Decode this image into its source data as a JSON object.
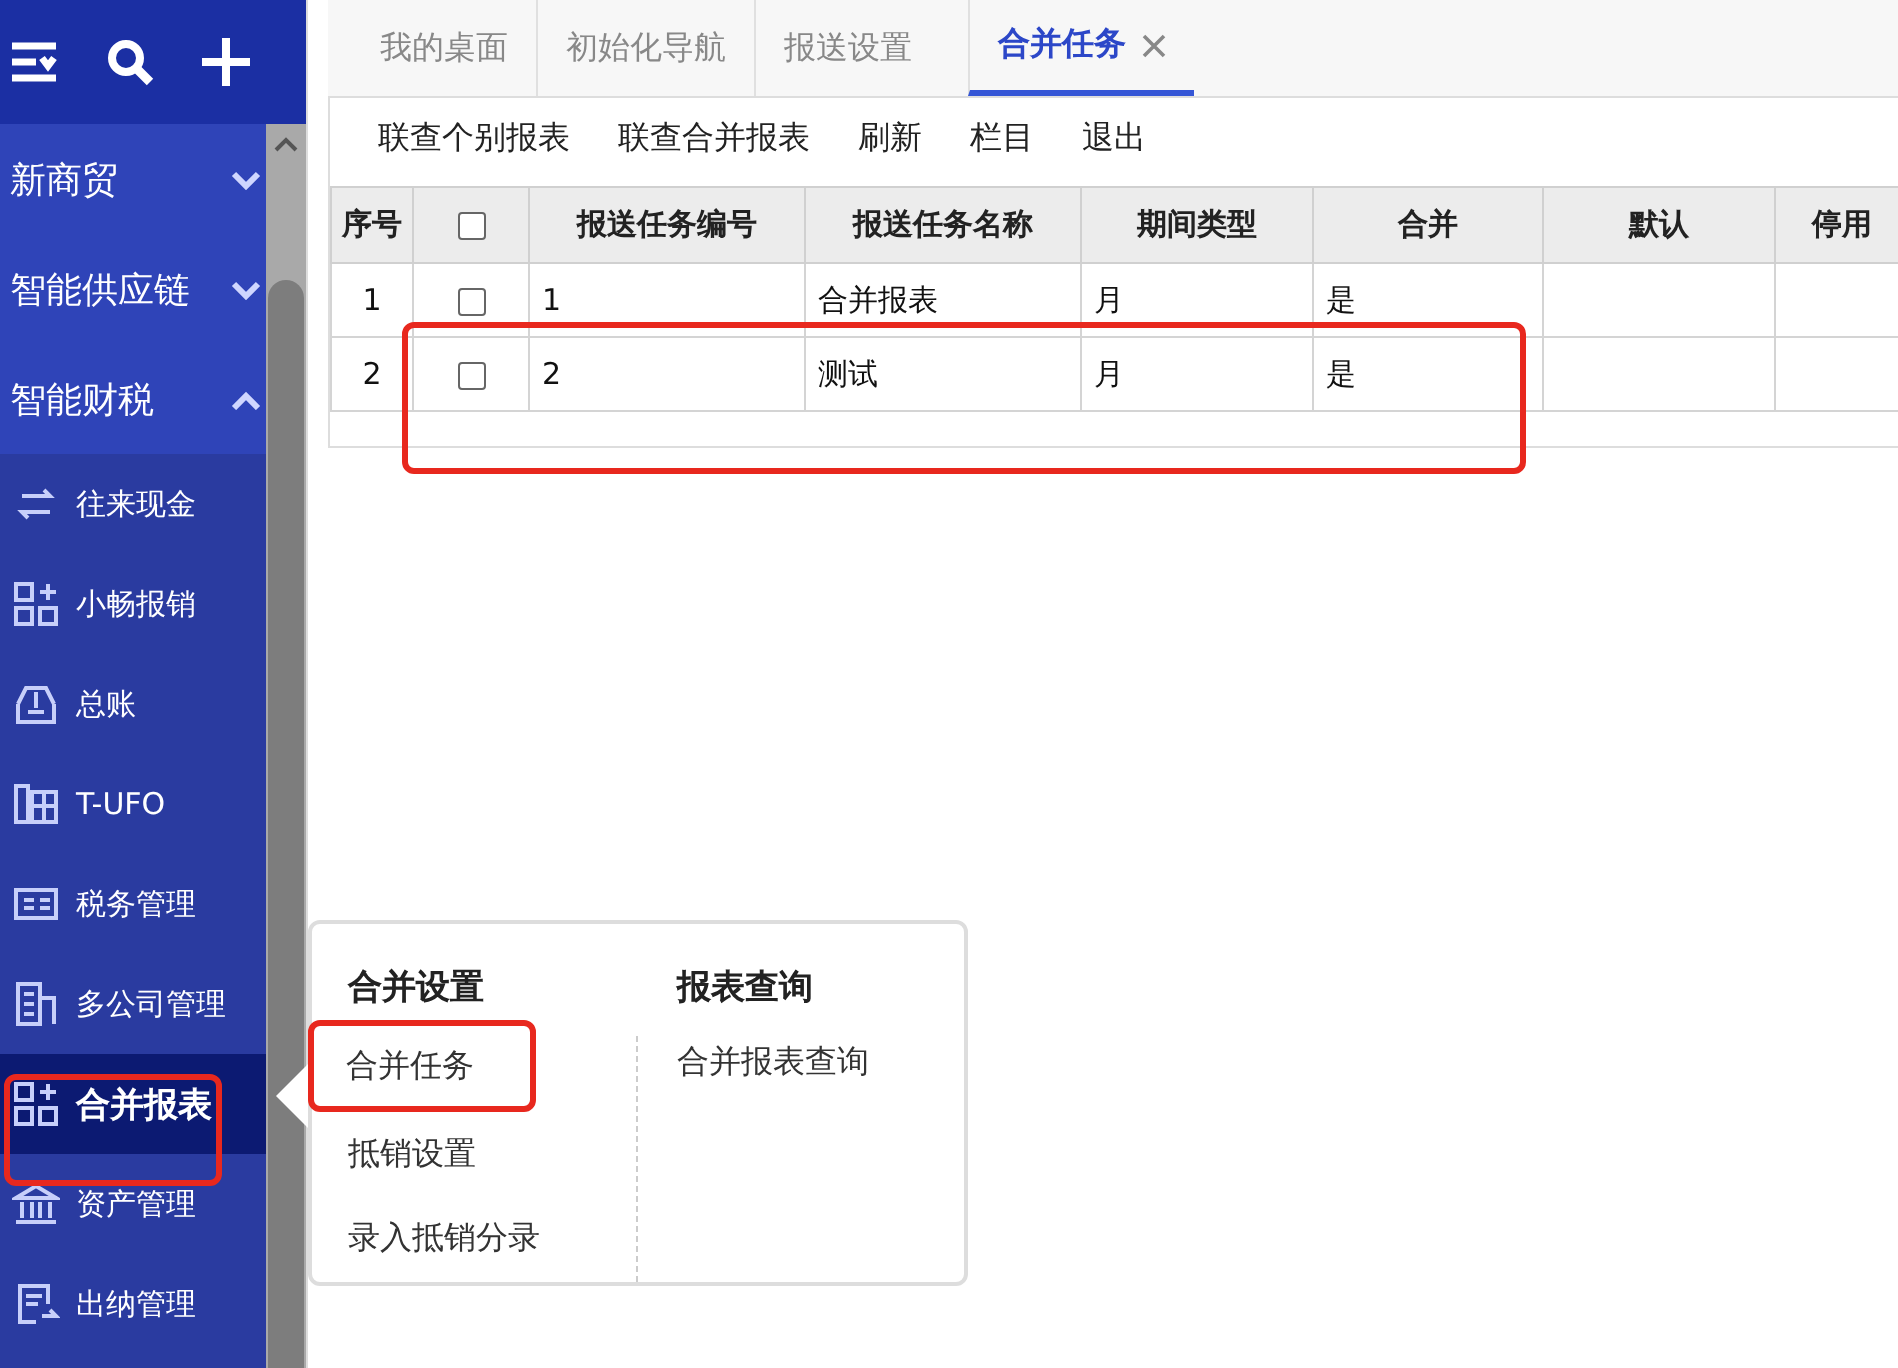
{
  "sidebar": {
    "sections": [
      {
        "label": "新商贸",
        "expanded": false
      },
      {
        "label": "智能供应链",
        "expanded": false
      },
      {
        "label": "智能财税",
        "expanded": true
      }
    ],
    "items": [
      {
        "label": "往来现金",
        "kind": "arrows",
        "selected": false
      },
      {
        "label": "小畅报销",
        "kind": "grid",
        "selected": false
      },
      {
        "label": "总账",
        "kind": "tray",
        "selected": false
      },
      {
        "label": "T-UFO",
        "kind": "ufo",
        "selected": false
      },
      {
        "label": "税务管理",
        "kind": "tax",
        "selected": false
      },
      {
        "label": "多公司管理",
        "kind": "building",
        "selected": false
      },
      {
        "label": "合并报表",
        "kind": "grid",
        "selected": true
      },
      {
        "label": "资产管理",
        "kind": "bank",
        "selected": false
      },
      {
        "label": "出纳管理",
        "kind": "doc",
        "selected": false
      }
    ]
  },
  "tabs": [
    {
      "label": "我的桌面",
      "selected": false,
      "closable": false
    },
    {
      "label": "初始化导航",
      "selected": false,
      "closable": false
    },
    {
      "label": "报送设置",
      "selected": false,
      "closable": false
    },
    {
      "label": "合并任务",
      "selected": true,
      "closable": true
    }
  ],
  "toolbar": [
    "联查个别报表",
    "联查合并报表",
    "刷新",
    "栏目",
    "退出"
  ],
  "table": {
    "all_checked": false,
    "columns": [
      "序号",
      "",
      "报送任务编号",
      "报送任务名称",
      "期间类型",
      "合并",
      "默认",
      "停用"
    ],
    "rows": [
      {
        "cells": [
          "1",
          "",
          "1",
          "合并报表",
          "月",
          "是",
          "",
          ""
        ],
        "checked": false
      },
      {
        "cells": [
          "2",
          "",
          "2",
          "测试",
          "月",
          "是",
          "",
          ""
        ],
        "checked": false
      }
    ]
  },
  "popup": {
    "groups": [
      {
        "title": "合并设置",
        "items": [
          {
            "label": "合并任务",
            "selected": true
          },
          {
            "label": "抵销设置",
            "selected": false
          },
          {
            "label": "录入抵销分录",
            "selected": false
          }
        ]
      },
      {
        "title": "报表查询",
        "items": [
          {
            "label": "合并报表查询",
            "selected": false
          }
        ]
      }
    ]
  }
}
